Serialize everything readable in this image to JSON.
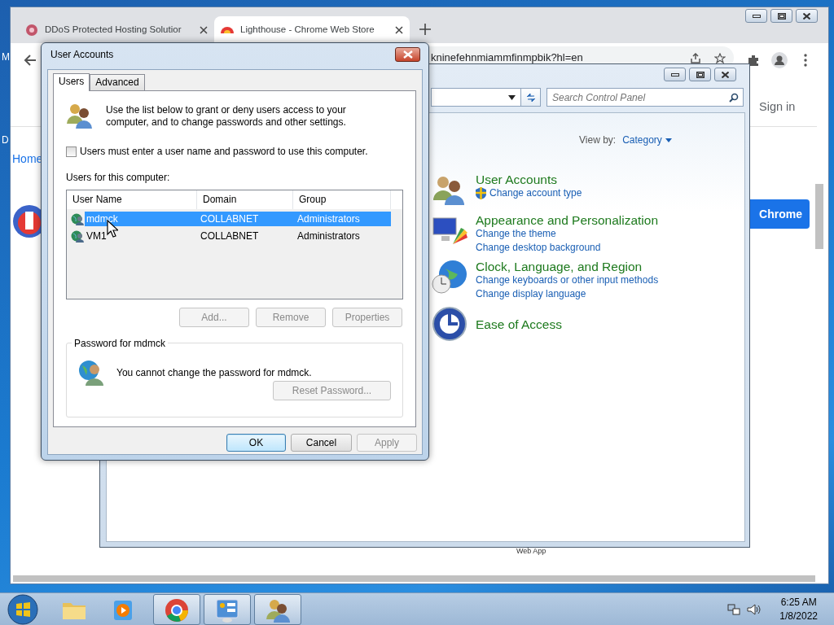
{
  "desktop": {
    "fragments": [
      "M",
      "D"
    ]
  },
  "browser": {
    "tabs": [
      {
        "title": "DDoS Protected Hosting Solutior",
        "selected": false
      },
      {
        "title": "Lighthouse - Chrome Web Store",
        "selected": true
      }
    ],
    "url": "kninefehnmiammfinmpbik?hl=en",
    "page": {
      "home_link": "Home",
      "sign_in": "Sign in",
      "install_button": "Chrome",
      "caption": "Web App"
    }
  },
  "control_panel": {
    "search": {
      "placeholder": "Search Control Panel"
    },
    "view_by": {
      "label": "View by:",
      "value": "Category"
    },
    "categories": [
      {
        "kind": "users",
        "title": "User Accounts",
        "links": [
          {
            "text": "Change account type",
            "shield": true
          }
        ]
      },
      {
        "kind": "appearance",
        "title": "Appearance and Personalization",
        "links": [
          {
            "text": "Change the theme",
            "shield": false
          },
          {
            "text": "Change desktop background",
            "shield": false
          }
        ]
      },
      {
        "kind": "clock",
        "title": "Clock, Language, and Region",
        "links": [
          {
            "text": "Change keyboards or other input methods",
            "shield": false
          },
          {
            "text": "Change display language",
            "shield": false
          }
        ]
      },
      {
        "kind": "access",
        "title": "Ease of Access"
      }
    ]
  },
  "dialog": {
    "title": "User Accounts",
    "tabs": [
      {
        "label": "Users",
        "selected": true
      },
      {
        "label": "Advanced",
        "selected": false
      }
    ],
    "intro": "Use the list below to grant or deny users access to your computer, and to change passwords and other settings.",
    "require_login": {
      "label": "Users must enter a user name and password to use this computer.",
      "checked": false
    },
    "list_label": "Users for this computer:",
    "columns": [
      "User Name",
      "Domain",
      "Group"
    ],
    "rows": [
      {
        "user": "mdmck",
        "domain": "COLLABNET",
        "group": "Administrators",
        "selected": true
      },
      {
        "user": "VM1",
        "domain": "COLLABNET",
        "group": "Administrators",
        "selected": false
      }
    ],
    "list_buttons": [
      {
        "label": "Add...",
        "disabled": true
      },
      {
        "label": "Remove",
        "disabled": true
      },
      {
        "label": "Properties",
        "disabled": true
      }
    ],
    "password": {
      "title": "Password for mdmck",
      "message": "You cannot change the password for mdmck.",
      "button": {
        "label": "Reset Password...",
        "disabled": true
      }
    },
    "footer_buttons": [
      {
        "label": "OK",
        "disabled": false,
        "default": true
      },
      {
        "label": "Cancel",
        "disabled": false,
        "default": false
      },
      {
        "label": "Apply",
        "disabled": true,
        "default": false
      }
    ]
  },
  "taskbar": {
    "apps": [
      {
        "kind": "folder",
        "running": false
      },
      {
        "kind": "media",
        "running": false
      },
      {
        "kind": "chrome",
        "running": true
      },
      {
        "kind": "control_panel",
        "running": true
      },
      {
        "kind": "users",
        "running": true
      }
    ],
    "time": "6:25 AM",
    "date": "1/8/2022"
  }
}
